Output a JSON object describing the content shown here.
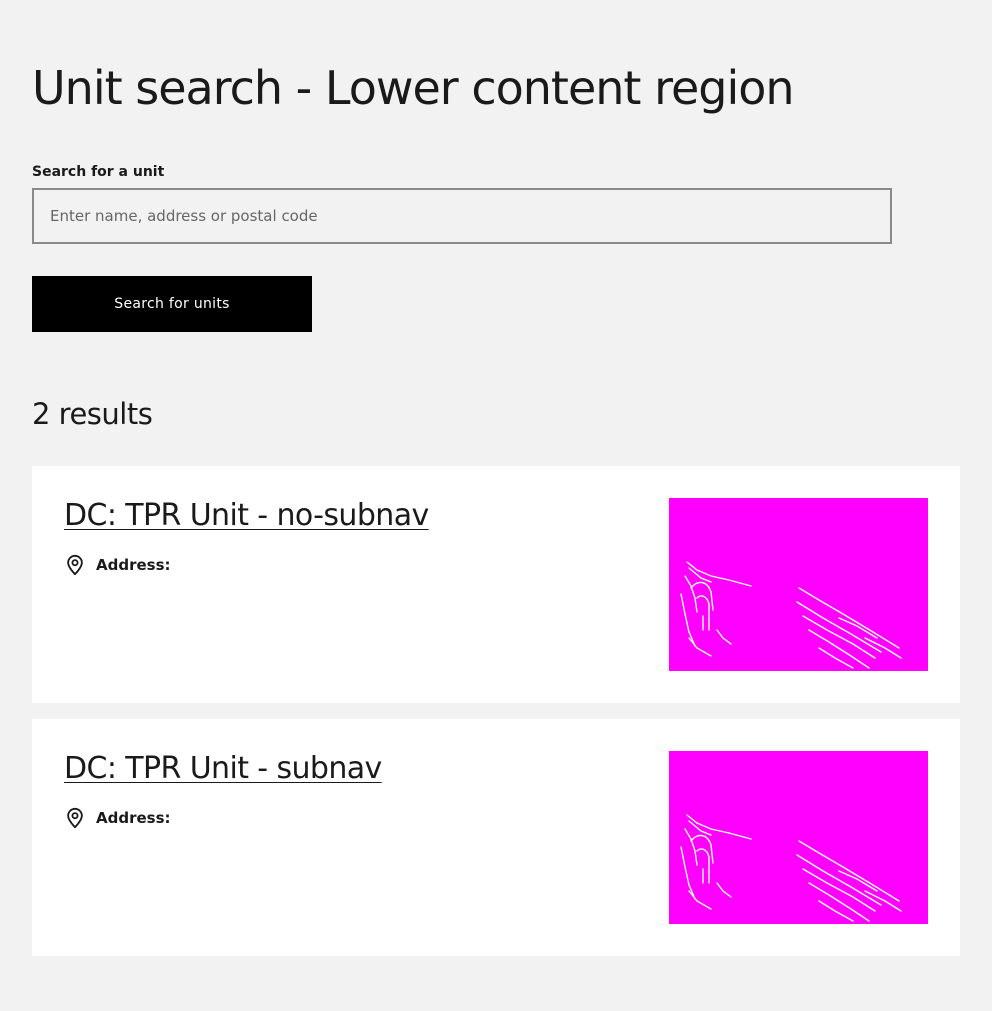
{
  "page": {
    "title": "Unit search - Lower content region"
  },
  "search": {
    "label": "Search for a unit",
    "placeholder": "Enter name, address or postal code",
    "value": "",
    "button_label": "Search for units"
  },
  "results": {
    "count_text": "2 results",
    "items": [
      {
        "title": "DC: TPR Unit - no-subnav",
        "address_label": "Address:"
      },
      {
        "title": "DC: TPR Unit - subnav",
        "address_label": "Address:"
      }
    ]
  },
  "colors": {
    "background": "#f2f2f2",
    "card": "#ffffff",
    "button": "#000000",
    "image_placeholder": "#ff00ff"
  },
  "icons": {
    "address": "location-pin-icon"
  }
}
